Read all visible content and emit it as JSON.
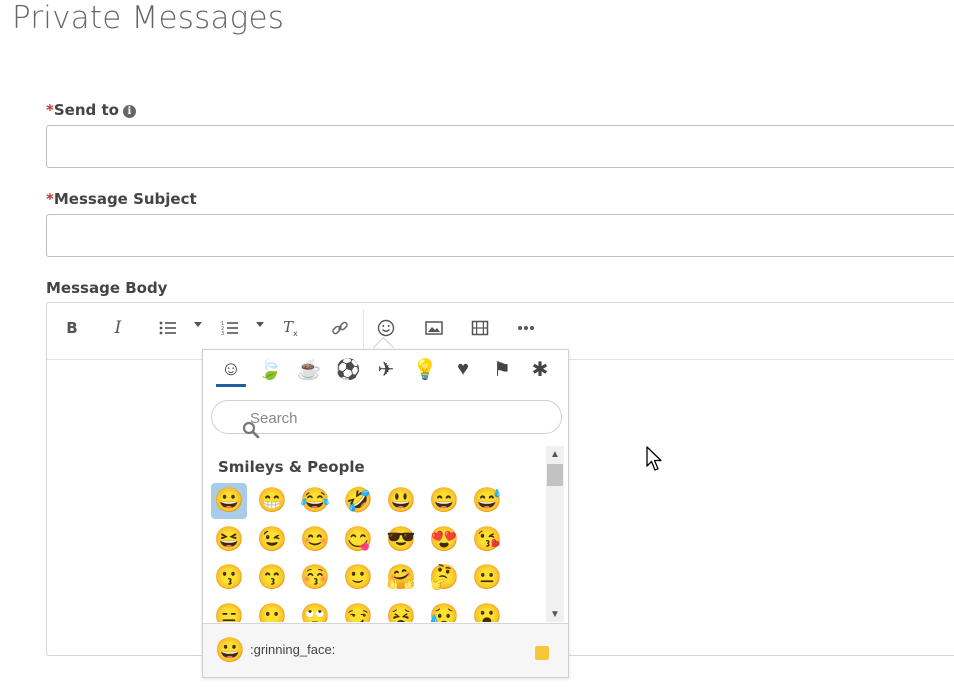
{
  "page": {
    "title": "Private Messages"
  },
  "form": {
    "required_mark": "*",
    "send_to_label": "Send to",
    "info_glyph": "i",
    "subject_label": "Message Subject",
    "body_label": "Message Body",
    "send_to_value": "",
    "subject_value": ""
  },
  "toolbar": {
    "bold": "B",
    "italic": "I"
  },
  "emoji_picker": {
    "categories": [
      {
        "name": "smileys",
        "glyph": "☺"
      },
      {
        "name": "nature",
        "glyph": "🍃"
      },
      {
        "name": "food",
        "glyph": "☕"
      },
      {
        "name": "activities",
        "glyph": "⚽"
      },
      {
        "name": "travel",
        "glyph": "✈"
      },
      {
        "name": "objects",
        "glyph": "💡"
      },
      {
        "name": "symbols",
        "glyph": "♥"
      },
      {
        "name": "flags",
        "glyph": "⚑"
      },
      {
        "name": "custom",
        "glyph": "✱"
      }
    ],
    "active_category": "smileys",
    "search_placeholder": "Search",
    "section_title": "Smileys & People",
    "emojis": [
      "😀",
      "😁",
      "😂",
      "🤣",
      "😃",
      "😄",
      "😅",
      "😆",
      "😉",
      "😊",
      "😋",
      "😎",
      "😍",
      "😘",
      "😗",
      "😙",
      "😚",
      "🙂",
      "🤗",
      "🤔",
      "😐",
      "😑",
      "😶",
      "🙄",
      "😏",
      "😣",
      "😥",
      "😮"
    ],
    "selected_index": 0,
    "preview_emoji": "😀",
    "preview_name": ":grinning_face:",
    "skin_tone_color": "#f7c73a"
  },
  "colors": {
    "required": "#c0392b",
    "accent": "#1f5f9e",
    "selected": "#a9cde6"
  }
}
